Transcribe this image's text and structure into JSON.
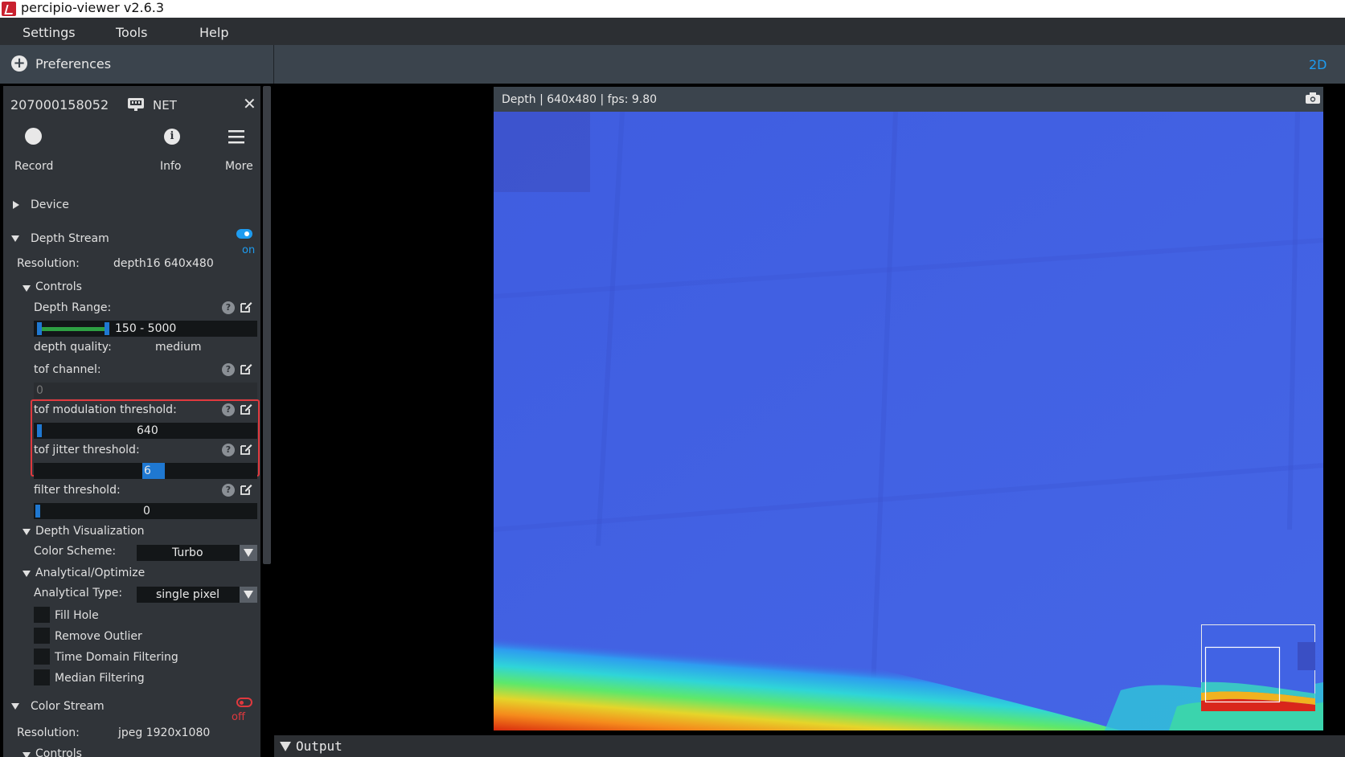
{
  "app": {
    "title": "percipio-viewer v2.6.3"
  },
  "menu": {
    "items": [
      "Settings",
      "Tools",
      "Help"
    ]
  },
  "preferences": {
    "label": "Preferences"
  },
  "view_mode": "2D",
  "device": {
    "serial": "207000158052",
    "connection": "NET",
    "actions": {
      "record": "Record",
      "info": "Info",
      "more": "More"
    },
    "section_device": "Device"
  },
  "depth_stream": {
    "title": "Depth Stream",
    "state": "on",
    "resolution_label": "Resolution:",
    "resolution_value": "depth16 640x480",
    "controls_title": "Controls",
    "depth_range_label": "Depth Range:",
    "depth_range_value": "150 - 5000",
    "depth_quality_label": "depth quality:",
    "depth_quality_value": "medium",
    "tof_channel_label": "tof channel:",
    "tof_channel_value": "0",
    "tof_modulation_label": "tof modulation threshold:",
    "tof_modulation_value": "640",
    "tof_jitter_label": "tof jitter threshold:",
    "tof_jitter_value": "6",
    "filter_threshold_label": "filter threshold:",
    "filter_threshold_value": "0",
    "visualization_title": "Depth Visualization",
    "color_scheme_label": "Color Scheme:",
    "color_scheme_value": "Turbo",
    "analytical_title": "Analytical/Optimize",
    "analytical_type_label": "Analytical Type:",
    "analytical_type_value": "single pixel",
    "checkboxes": [
      "Fill Hole",
      "Remove Outlier",
      "Time Domain Filtering",
      "Median Filtering"
    ]
  },
  "color_stream": {
    "title": "Color Stream",
    "state": "off",
    "resolution_label": "Resolution:",
    "resolution_value": "jpeg 1920x1080",
    "controls_title": "Controls"
  },
  "viewer": {
    "title": "Depth | 640x480 | fps: 9.80"
  },
  "output": {
    "label": "Output"
  },
  "colors": {
    "accent": "#1e9cf0",
    "highlight_box": "#e0393e",
    "off": "#e0393e"
  }
}
